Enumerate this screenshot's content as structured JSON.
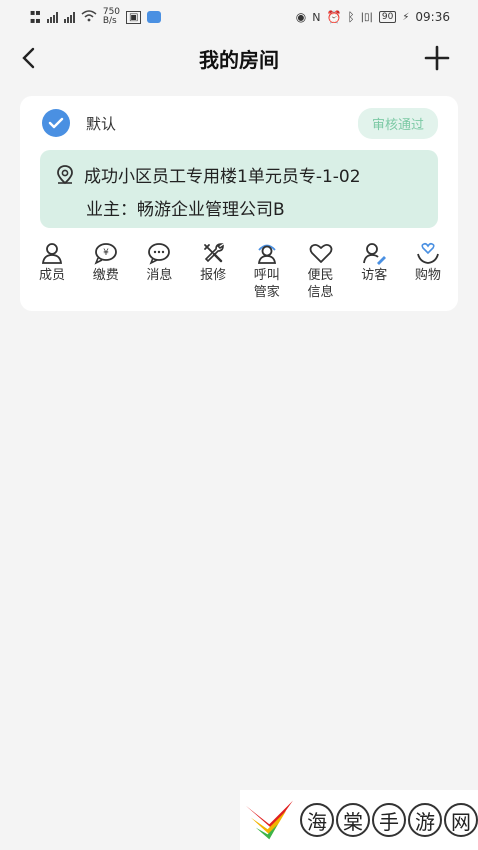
{
  "status_bar": {
    "net_speed_value": "750",
    "net_speed_unit": "B/s",
    "battery": "90",
    "time": "09:36"
  },
  "header": {
    "title": "我的房间",
    "back_icon": "chevron-left-icon",
    "add_icon": "plus-icon"
  },
  "room": {
    "default_label": "默认",
    "status_badge": "审核通过",
    "address": "成功小区员工专用楼1单元员专-1-02",
    "owner": "业主：畅游企业管理公司B",
    "colors": {
      "check": "#4a90e2",
      "badge_bg": "#e2f3ec",
      "badge_text": "#7cc9a5",
      "address_bg": "#d9efe6"
    }
  },
  "actions": [
    {
      "label": "成员",
      "icon": "member-icon"
    },
    {
      "label": "缴费",
      "icon": "payment-icon"
    },
    {
      "label": "消息",
      "icon": "message-icon"
    },
    {
      "label": "报修",
      "icon": "repair-icon"
    },
    {
      "label": "呼叫管家",
      "icon": "call-butler-icon"
    },
    {
      "label": "便民信息",
      "icon": "convenience-info-icon"
    },
    {
      "label": "访客",
      "icon": "visitor-icon"
    },
    {
      "label": "购物",
      "icon": "shopping-icon"
    }
  ],
  "watermark": {
    "chars": [
      "海",
      "棠",
      "手",
      "游",
      "网"
    ]
  }
}
